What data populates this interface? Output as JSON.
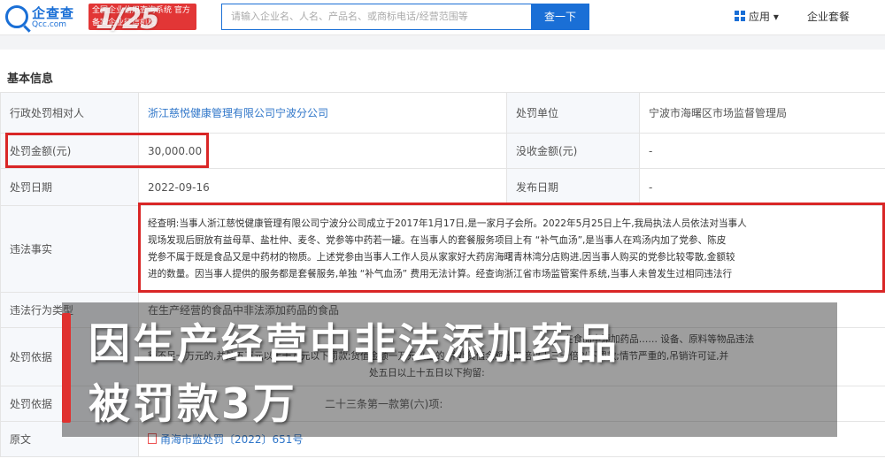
{
  "header": {
    "logo_text": "企查查",
    "logo_domain": "Qcc.com",
    "badge_text": "全国企业信用查询系统 官方备案企业征信机构",
    "watermark": "1/25",
    "search_placeholder": "请输入企业名、人名、产品名、或商标电话/经营范围等",
    "search_button": "查一下",
    "nav_app": "应用",
    "nav_site": "企业套餐"
  },
  "section": {
    "title": "基本信息"
  },
  "rows": {
    "target_label": "行政处罚相对人",
    "target_value": "浙江慈悦健康管理有限公司宁波分公司",
    "authority_label": "处罚单位",
    "authority_value": "宁波市海曙区市场监督管理局",
    "amount_label": "处罚金额(元)",
    "amount_value": "30,000.00",
    "confiscation_label": "没收金额(元)",
    "confiscation_value": "-",
    "date_label": "处罚日期",
    "date_value": "2022-09-16",
    "publish_label": "发布日期",
    "publish_value": "-",
    "facts_label": "违法事实",
    "facts_lines": [
      "经查明:当事人浙江慈悦健康管理有限公司宁波分公司成立于2017年1月17日,是一家月子会所。2022年5月25日上午,我局执法人员依法对当事人",
      "现场发现后厨放有益母草、盐杜仲、麦冬、党参等中药若一罐。在当事人的套餐服务项目上有 “补气血汤”,是当事人在鸡汤内加了党参、陈皮",
      "党参不属于既是食品又是中药材的物质。上述党参由当事人工作人员从家家好大药房海曙青林湾分店购进,因当事人购买的党参比较零散,金额较",
      "进的数量。因当事人提供的服务都是套餐服务,单独 “补气血汤” 费用无法计算。经查询浙江省市场监管案件系统,当事人未曾发生过相同违法行"
    ],
    "type_label": "违法行为类型",
    "type_value": "在生产经营的食品中非法添加药品的食品",
    "basis_label": "处罚依据",
    "basis_lines": [
      "在食品中添加药品…… 设备、原料等物品违法",
      "额不足一万元的,并处五万元以上十万元以下罚款;货值金额一万元以上的,并处货值金额十五倍以上三十倍以下罚款;情节严重的,吊销许可证,并",
      "处五日以上十五日以下拘留:"
    ],
    "result_label": "处罚依据",
    "result_value": "二十三条第一款第(六)项:",
    "original_label": "原文",
    "original_value": "甬海市监处罚〔2022〕651号"
  },
  "caption": {
    "line1": "因生产经营中非法添加药品",
    "line2": "被罚款3万"
  },
  "colors": {
    "brand": "#1a6fd6",
    "highlight": "#d92626",
    "link": "#2f76c9"
  }
}
